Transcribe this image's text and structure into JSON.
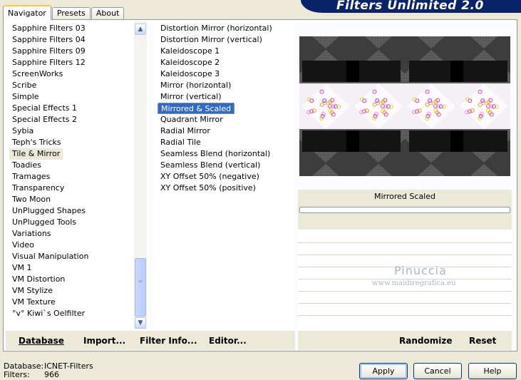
{
  "tabs": [
    {
      "label": "Navigator",
      "active": true
    },
    {
      "label": "Presets",
      "active": false
    },
    {
      "label": "About",
      "active": false
    }
  ],
  "banner": {
    "title": "Filters Unlimited 2.0"
  },
  "categories": {
    "selected": "Tile & Mirror",
    "items": [
      "Sapphire Filters 03",
      "Sapphire Filters 04",
      "Sapphire Filters 09",
      "Sapphire Filters 12",
      "ScreenWorks",
      "Scribe",
      "Simple",
      "Special Effects 1",
      "Special Effects 2",
      "Sybia",
      "Teph's Tricks",
      "Tile & Mirror",
      "Toadies",
      "Tramages",
      "Transparency",
      "Two Moon",
      "UnPlugged Shapes",
      "UnPlugged Tools",
      "Variations",
      "Video",
      "Visual Manipulation",
      "VM 1",
      "VM Distortion",
      "VM Stylize",
      "VM Texture",
      "°v° Kiwi`s Oelfilter"
    ]
  },
  "filters": {
    "selected": "Mirrored & Scaled",
    "items": [
      "Distortion Mirror (horizontal)",
      "Distortion Mirror (vertical)",
      "Kaleidoscope 1",
      "Kaleidoscope 2",
      "Kaleidoscope 3",
      "Mirror (horizontal)",
      "Mirror (vertical)",
      "Mirrored & Scaled",
      "Quadrant Mirror",
      "Radial Mirror",
      "Radial Tile",
      "Seamless Blend (horizontal)",
      "Seamless Blend (vertical)",
      "XY Offset 50% (negative)",
      "XY Offset 50% (positive)"
    ]
  },
  "preview": {
    "filter_name": "Mirrored  Scaled"
  },
  "watermark": {
    "name": "Pinuccia",
    "url": "www.maidiregrafica.eu"
  },
  "toolbar": {
    "database": "Database",
    "import": "Import...",
    "filter_info": "Filter Info...",
    "editor": "Editor...",
    "randomize": "Randomize",
    "reset": "Reset"
  },
  "status": {
    "database_label": "Database:",
    "database_value": "ICNET-Filters",
    "filters_label": "Filters:",
    "filters_value": "966"
  },
  "buttons": {
    "apply": "Apply",
    "cancel": "Cancel",
    "help": "Help"
  },
  "colors": {
    "selection": "#316ac5",
    "banner": "#0a246a"
  }
}
